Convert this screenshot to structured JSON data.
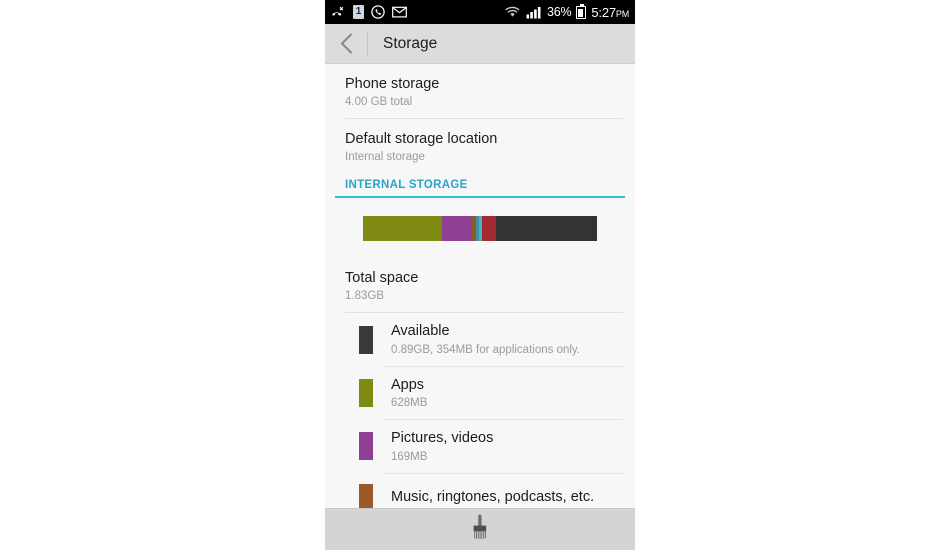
{
  "statusbar": {
    "icons_left": [
      "missed-call-icon",
      "notification-badge-icon",
      "whatsapp-icon",
      "gmail-icon"
    ],
    "badge_text": "1",
    "icons_right": [
      "wifi-icon",
      "signal-icon",
      "battery-icon"
    ],
    "battery_percent": "36%",
    "time": "5:27",
    "ampm": "PM"
  },
  "actionbar": {
    "back_icon": "back-chevron-icon",
    "title": "Storage"
  },
  "settings_rows": [
    {
      "title": "Phone storage",
      "subtitle": "4.00 GB total"
    },
    {
      "title": "Default storage location",
      "subtitle": "Internal storage"
    }
  ],
  "section": {
    "label": "INTERNAL STORAGE",
    "accent": "#38bcd8"
  },
  "usage_bar": {
    "segments": [
      {
        "name": "apps",
        "color": "#7f8a13",
        "width_pct": 34.0
      },
      {
        "name": "pictures-videos",
        "color": "#8f3f94",
        "width_pct": 12.0
      },
      {
        "name": "music-ringtones",
        "color": "#8a5a2b",
        "width_pct": 2.3
      },
      {
        "name": "downloads",
        "color": "#3f8fa8",
        "width_pct": 1.5
      },
      {
        "name": "cached",
        "color": "#46b6c4",
        "width_pct": 1.2
      },
      {
        "name": "misc",
        "color": "#a32a33",
        "width_pct": 6.0
      },
      {
        "name": "available",
        "color": "#333333",
        "width_pct": 43.0
      }
    ]
  },
  "total_space": {
    "title": "Total space",
    "subtitle": "1.83GB"
  },
  "storage_items": [
    {
      "title": "Available",
      "subtitle": "0.89GB, 354MB for applications only.",
      "color": "#3a3a3a"
    },
    {
      "title": "Apps",
      "subtitle": "628MB",
      "color": "#7f8a13"
    },
    {
      "title": "Pictures, videos",
      "subtitle": "169MB",
      "color": "#8f3f94"
    },
    {
      "title": "Music, ringtones, podcasts, etc.",
      "subtitle": "",
      "color": "#9a5a2a"
    }
  ],
  "navbar": {
    "icon": "brush-stamp-icon"
  }
}
